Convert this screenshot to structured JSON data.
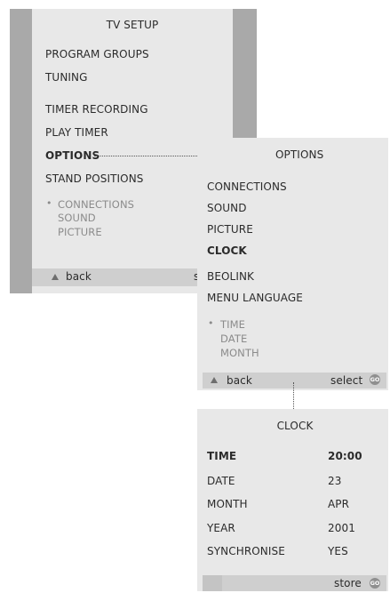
{
  "tv_setup": {
    "title": "TV SETUP",
    "items": [
      "PROGRAM GROUPS",
      "TUNING",
      "TIMER RECORDING",
      "PLAY TIMER",
      "OPTIONS",
      "STAND POSITIONS"
    ],
    "sub_items": [
      "CONNECTIONS",
      "SOUND",
      "PICTURE"
    ],
    "footer": {
      "back": "back",
      "select": "select"
    }
  },
  "options": {
    "title": "OPTIONS",
    "items": [
      "CONNECTIONS",
      "SOUND",
      "PICTURE",
      "CLOCK",
      "BEOLINK",
      "MENU LANGUAGE"
    ],
    "sub_items": [
      "TIME",
      "DATE",
      "MONTH"
    ],
    "footer": {
      "back": "back",
      "select": "select",
      "go": "GO"
    }
  },
  "clock": {
    "title": "CLOCK",
    "rows": [
      {
        "label": "TIME",
        "value": "20:00"
      },
      {
        "label": "DATE",
        "value": "23"
      },
      {
        "label": "MONTH",
        "value": "APR"
      },
      {
        "label": "YEAR",
        "value": "2001"
      },
      {
        "label": "SYNCHRONISE",
        "value": "YES"
      }
    ],
    "footer": {
      "store": "store",
      "go": "GO"
    }
  },
  "colors": {
    "panel": "#e8e8e8",
    "side_bar": "#a9a9a9",
    "footer": "#cfcfcf"
  }
}
